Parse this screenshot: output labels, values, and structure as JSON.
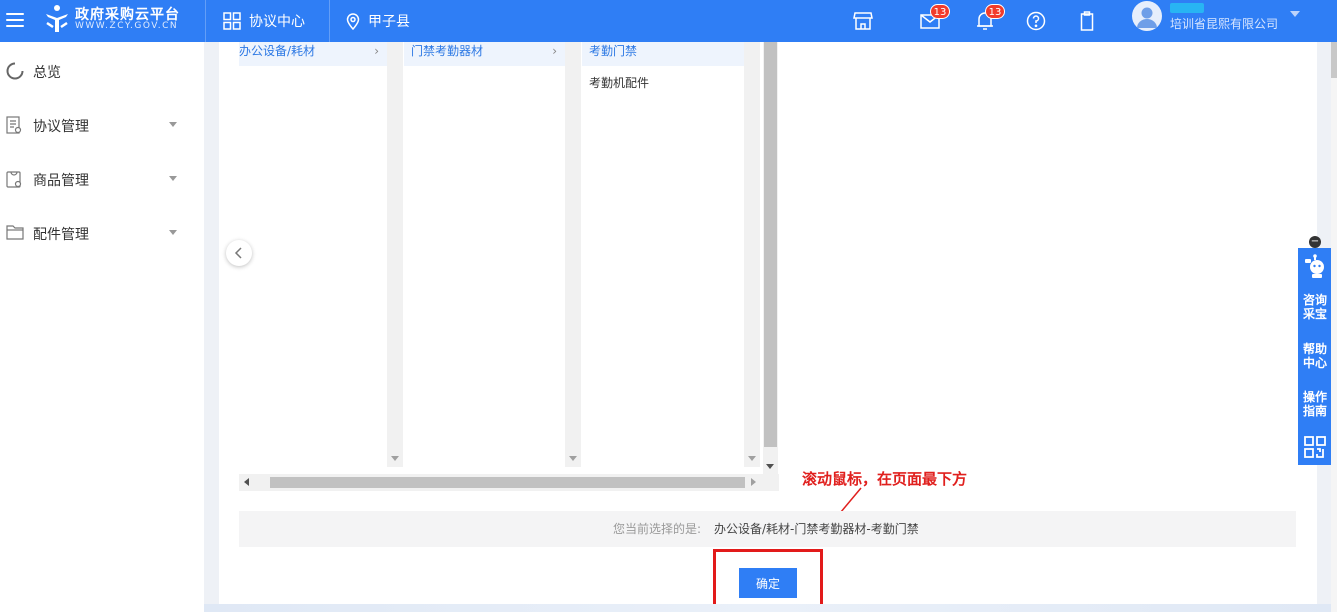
{
  "header": {
    "logo_title": "政府采购云平台",
    "logo_sub": "WWW.ZCY.GOV.CN",
    "nav": [
      {
        "label": "协议中心",
        "icon": "grid-icon"
      },
      {
        "label": "甲子县",
        "icon": "location-pin-icon"
      }
    ],
    "icons": {
      "store": "store-icon",
      "mail": "mail-icon",
      "bell": "bell-icon",
      "help": "help-circle-icon",
      "clipboard": "clipboard-icon"
    },
    "mail_count": "13",
    "bell_count": "13",
    "company": "培训省昆熙有限公司"
  },
  "sidebar": {
    "items": [
      {
        "label": "总览",
        "icon": "overview-ring-icon",
        "expandable": false
      },
      {
        "label": "协议管理",
        "icon": "document-icon",
        "expandable": true
      },
      {
        "label": "商品管理",
        "icon": "goods-icon",
        "expandable": true
      },
      {
        "label": "配件管理",
        "icon": "folder-icon",
        "expandable": true
      }
    ]
  },
  "category": {
    "col1": [
      {
        "label": "办公设备/耗材",
        "selected": true
      }
    ],
    "col2": [
      {
        "label": "门禁考勤器材",
        "selected": true
      }
    ],
    "col3": [
      {
        "label": "考勤门禁",
        "selected": true
      },
      {
        "label": "考勤机配件",
        "selected": false
      }
    ]
  },
  "annotation": "滚动鼠标，在页面最下方",
  "selection": {
    "label": "您当前选择的是:",
    "value": "办公设备/耗材-门禁考勤器材-考勤门禁"
  },
  "confirm_label": "确定",
  "helper": {
    "minimize": "−",
    "items": [
      "咨询\n采宝",
      "帮助\n中心",
      "操作\n指南"
    ],
    "qr_icon": "qr-code-icon",
    "robot_icon": "robot-icon"
  },
  "colors": {
    "primary": "#2f7ef5",
    "annotation_red": "#e0201e",
    "selected_bg": "#eef4fd",
    "selected_text": "#2c78e4"
  }
}
